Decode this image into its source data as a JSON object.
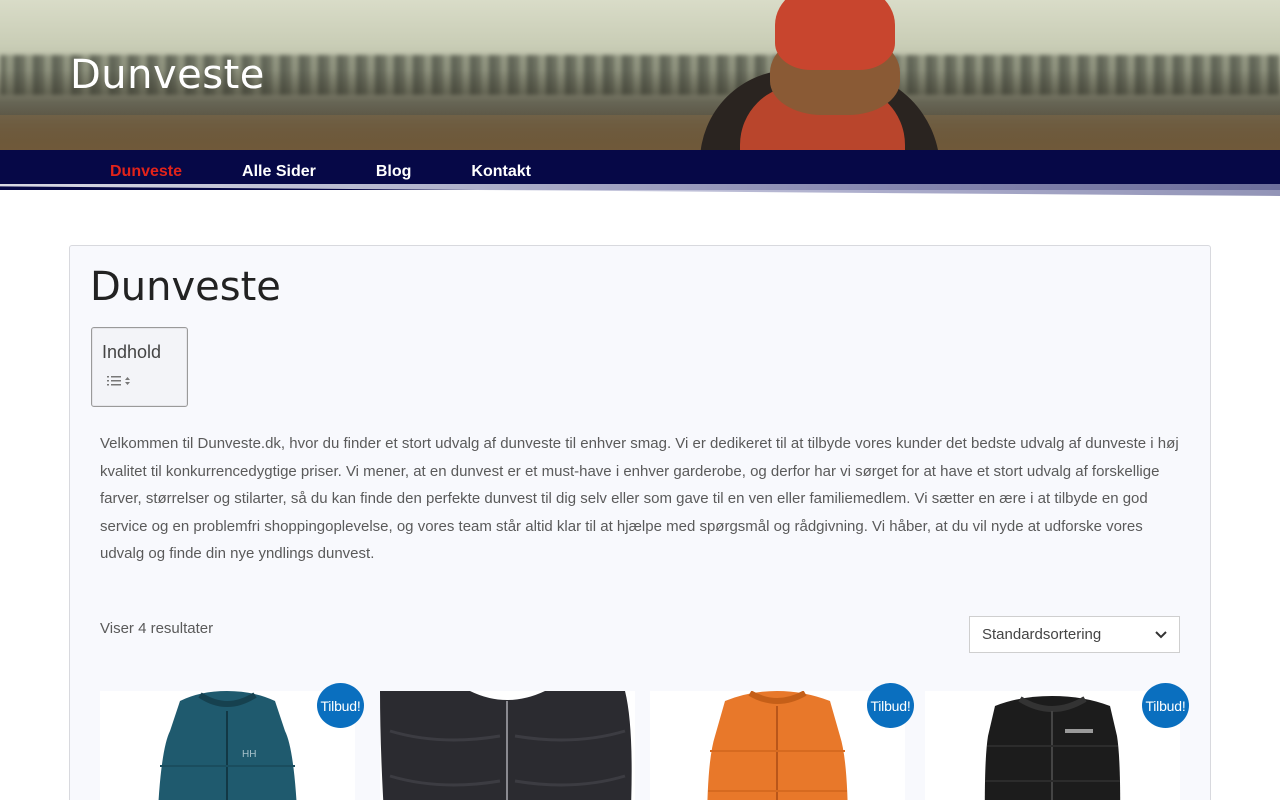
{
  "header": {
    "site_title": "Dunveste"
  },
  "nav": {
    "items": [
      {
        "label": "Dunveste",
        "active": true
      },
      {
        "label": "Alle Sider",
        "active": false
      },
      {
        "label": "Blog",
        "active": false
      },
      {
        "label": "Kontakt",
        "active": false
      }
    ]
  },
  "main": {
    "title": "Dunveste",
    "toc": {
      "title": "Indhold",
      "toggle_icon": "list-toggle-icon"
    },
    "intro": "Velkommen til Dunveste.dk, hvor du finder et stort udvalg af dunveste til enhver smag. Vi er dedikeret til at tilbyde vores kunder det bedste udvalg af dunveste i høj kvalitet til konkurrencedygtige priser. Vi mener, at en dunvest er et must-have i enhver garderobe, og derfor har vi sørget for at have et stort udvalg af forskellige farver, størrelser og stilarter, så du kan finde den perfekte dunvest til dig selv eller som gave til en ven eller familiemedlem. Vi sætter en ære i at tilbyde en god service og en problemfri shoppingoplevelse, og vores team står altid klar til at hjælpe med spørgsmål og rådgivning. Vi håber, at du vil nyde at udforske vores udvalg og finde din nye yndlings dunvest.",
    "result_count": "Viser 4 resultater",
    "sort": {
      "selected": "Standardsortering"
    },
    "products": [
      {
        "badge": "Tilbud!",
        "color": "#1f5a6e"
      },
      {
        "badge": "",
        "color": "#2b2b30"
      },
      {
        "badge": "Tilbud!",
        "color": "#e8782a"
      },
      {
        "badge": "Tilbud!",
        "color": "#1c1c1c"
      }
    ]
  },
  "colors": {
    "nav_bg": "#060847",
    "nav_active": "#e2231a",
    "badge_bg": "#0a6fbf"
  }
}
